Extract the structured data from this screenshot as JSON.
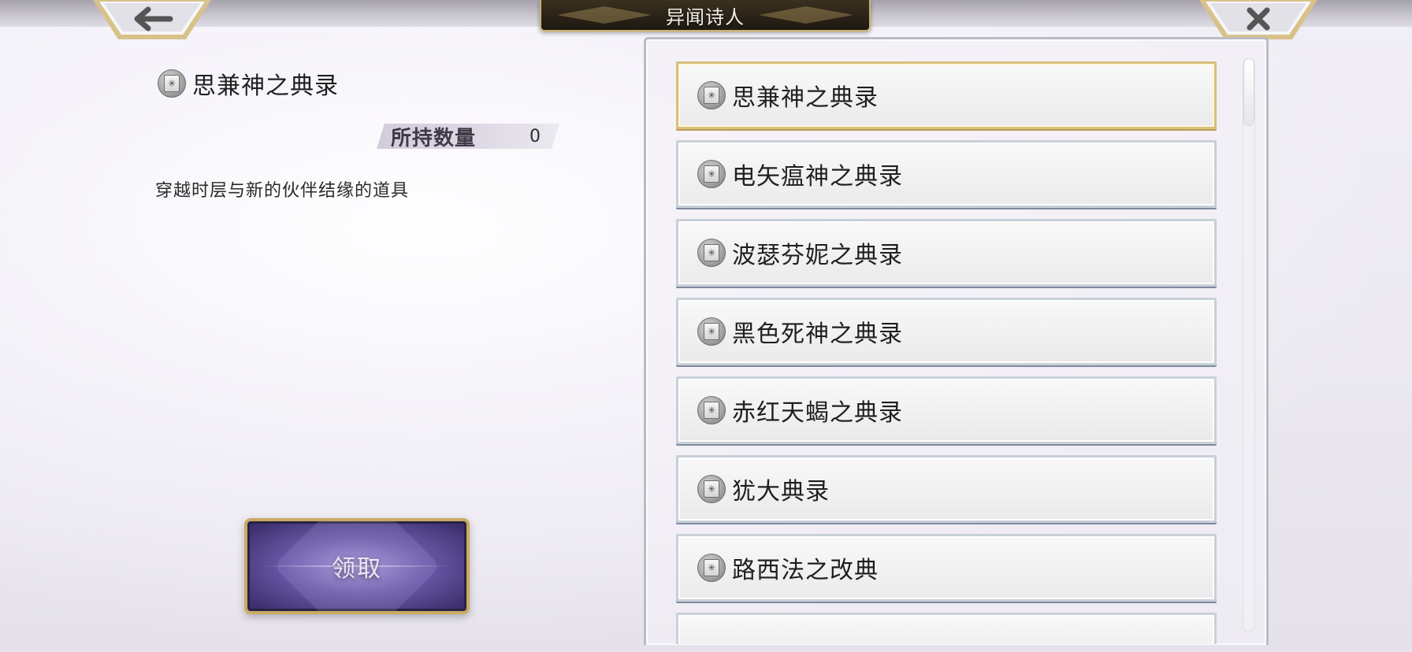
{
  "header": {
    "title": "异闻诗人",
    "back_icon": "back-arrow-icon",
    "close_icon": "close-x-icon"
  },
  "detail": {
    "item_icon": "book-icon",
    "item_name": "思兼神之典录",
    "count_label": "所持数量",
    "count_value": "0",
    "description": "穿越时层与新的伙伴结缘的道具",
    "claim_label": "领取"
  },
  "list": {
    "items": [
      {
        "label": "思兼神之典录",
        "selected": true,
        "icon": "book-icon"
      },
      {
        "label": "电矢瘟神之典录",
        "selected": false,
        "icon": "book-icon"
      },
      {
        "label": "波瑟芬妮之典录",
        "selected": false,
        "icon": "book-icon"
      },
      {
        "label": "黑色死神之典录",
        "selected": false,
        "icon": "book-icon"
      },
      {
        "label": "赤红天蝎之典录",
        "selected": false,
        "icon": "book-icon"
      },
      {
        "label": "犹大典录",
        "selected": false,
        "icon": "book-icon"
      },
      {
        "label": "路西法之改典",
        "selected": false,
        "icon": "book-icon"
      }
    ]
  },
  "colors": {
    "gold_frame": "#cdb36f",
    "selected_border": "#d8bf7a",
    "claim_button": "#5c48a0"
  }
}
